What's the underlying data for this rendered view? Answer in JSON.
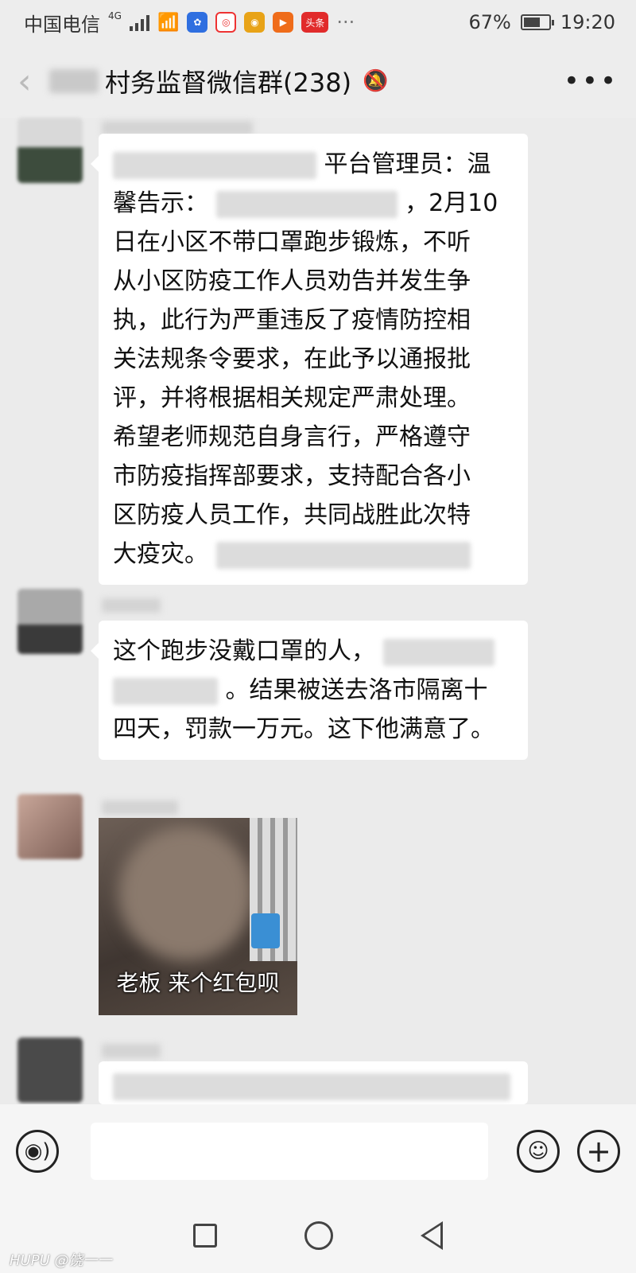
{
  "status_bar": {
    "carrier": "中国电信",
    "network": "4G",
    "app_icons": [
      "baidu-icon",
      "browser-icon",
      "weibo-icon",
      "video-icon",
      "toutiao-icon"
    ],
    "toutiao_label": "头条",
    "more": "···",
    "battery": "67%",
    "battery_level": 0.67,
    "time": "19:20"
  },
  "header": {
    "back_icon": "back-arrow-icon",
    "title": "村务监督微信群(238)",
    "mute_icon": "bell-muted-icon",
    "more": "•••"
  },
  "messages": [
    {
      "type": "text",
      "parts": [
        "平台管理员：温",
        "馨告示：",
        "，2月10",
        "日在小区不带口罩跑步锻炼，不听",
        "从小区防疫工作人员劝告并发生争",
        "执，此行为严重违反了疫情防控相",
        "关法规条令要求，在此予以通报批",
        "评，并将根据相关规定严肃处理。",
        "希望老师规范自身言行，严格遵守",
        "市防疫指挥部要求，支持配合各小",
        "区防疫人员工作，共同战胜此次特",
        "大疫灾。"
      ]
    },
    {
      "type": "text",
      "parts": [
        "这个跑步没戴口罩的人，",
        "。结果被送去洛市隔离十",
        "四天，罚款一万元。这下他满意了。"
      ]
    },
    {
      "type": "sticker",
      "caption": "老板 来个红包呗"
    }
  ],
  "input_bar": {
    "voice_icon": "voice-icon",
    "emoji_icon": "emoji-icon",
    "plus_icon": "plus-icon"
  },
  "nav_bar": {
    "recent_icon": "square-icon",
    "home_icon": "circle-icon",
    "back_icon": "triangle-back-icon"
  },
  "watermark": "HUPU @饶一一"
}
